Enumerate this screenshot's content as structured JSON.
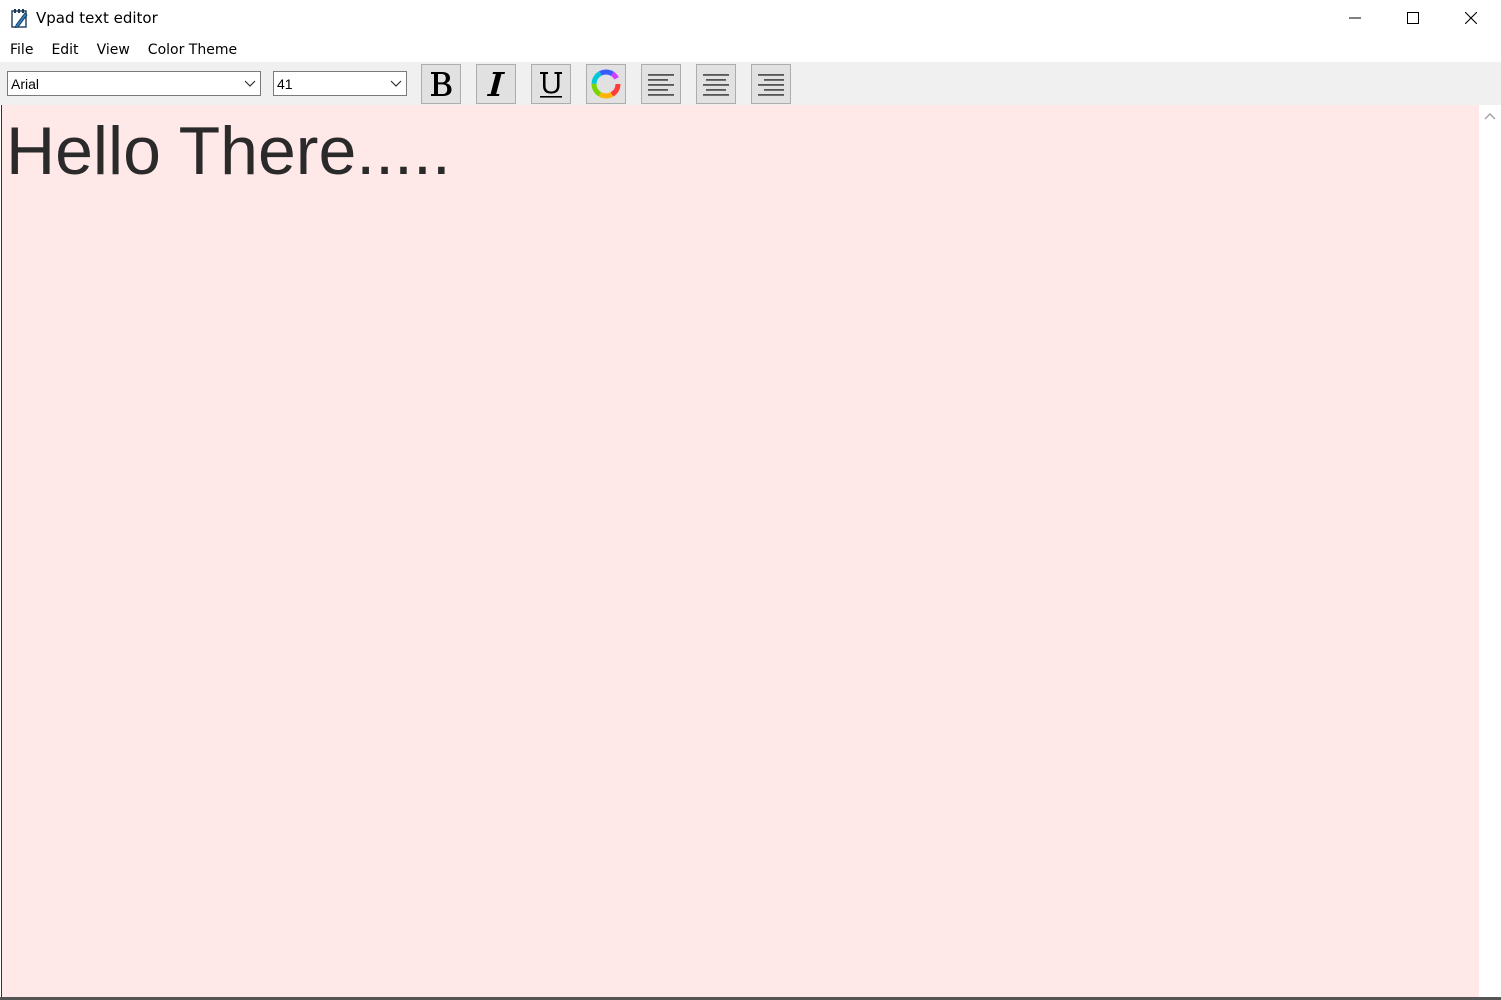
{
  "window": {
    "title": "Vpad text editor",
    "app_icon": "notepad-pen-icon",
    "controls": {
      "minimize_icon": "minimize-icon",
      "maximize_icon": "maximize-icon",
      "close_icon": "close-icon"
    }
  },
  "menu": {
    "items": [
      {
        "label": "File"
      },
      {
        "label": "Edit"
      },
      {
        "label": "View"
      },
      {
        "label": "Color Theme"
      }
    ]
  },
  "toolbar": {
    "font_family": "Arial",
    "font_size": "41",
    "buttons": [
      {
        "name": "bold",
        "icon": "bold-icon"
      },
      {
        "name": "italic",
        "icon": "italic-icon"
      },
      {
        "name": "underline",
        "icon": "underline-icon"
      },
      {
        "name": "font-color",
        "icon": "color-wheel-icon"
      },
      {
        "name": "align-left",
        "icon": "align-left-icon"
      },
      {
        "name": "align-center",
        "icon": "align-center-icon"
      },
      {
        "name": "align-right",
        "icon": "align-right-icon"
      }
    ]
  },
  "editor": {
    "content": "Hello There.....",
    "background": "#ffe8e8",
    "text_color": "#2a2a2a"
  }
}
